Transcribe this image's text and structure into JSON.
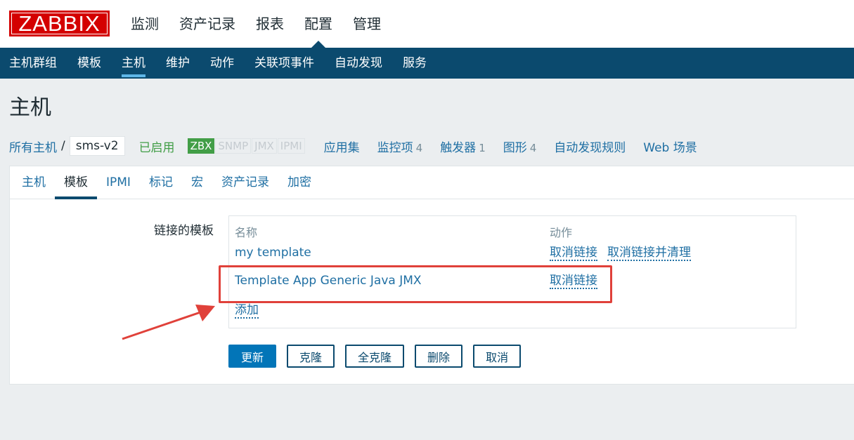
{
  "logo": {
    "text": "ZABBIX"
  },
  "main_nav": [
    {
      "label": "监测"
    },
    {
      "label": "资产记录"
    },
    {
      "label": "报表"
    },
    {
      "label": "配置",
      "active": true
    },
    {
      "label": "管理"
    }
  ],
  "sub_nav": [
    {
      "label": "主机群组"
    },
    {
      "label": "模板"
    },
    {
      "label": "主机",
      "active": true
    },
    {
      "label": "维护"
    },
    {
      "label": "动作"
    },
    {
      "label": "关联项事件"
    },
    {
      "label": "自动发现"
    },
    {
      "label": "服务"
    }
  ],
  "page_title": "主机",
  "breadcrumb": {
    "all_hosts": "所有主机",
    "separator": "/",
    "host": "sms-v2",
    "status": "已启用",
    "availability": [
      "ZBX",
      "SNMP",
      "JMX",
      "IPMI"
    ],
    "links": [
      {
        "label": "应用集",
        "count": ""
      },
      {
        "label": "监控项",
        "count": "4"
      },
      {
        "label": "触发器",
        "count": "1"
      },
      {
        "label": "图形",
        "count": "4"
      },
      {
        "label": "自动发现规则",
        "count": ""
      },
      {
        "label": "Web 场景",
        "count": ""
      }
    ]
  },
  "tabs": [
    {
      "label": "主机"
    },
    {
      "label": "模板",
      "active": true
    },
    {
      "label": "IPMI"
    },
    {
      "label": "标记"
    },
    {
      "label": "宏"
    },
    {
      "label": "资产记录"
    },
    {
      "label": "加密"
    }
  ],
  "form": {
    "linked_label": "链接的模板",
    "columns": {
      "name": "名称",
      "action": "动作"
    },
    "templates": [
      {
        "name": "my template",
        "actions": [
          "取消链接",
          "取消链接并清理"
        ]
      },
      {
        "name": "Template App Generic Java JMX",
        "actions": [
          "取消链接"
        ]
      }
    ],
    "add_label": "添加"
  },
  "buttons": {
    "update": "更新",
    "clone": "克隆",
    "full_clone": "全克隆",
    "delete": "删除",
    "cancel": "取消"
  },
  "colors": {
    "brand": "#d40000",
    "nav": "#0b4a6e",
    "link": "#1f6fa3",
    "enabled": "#429e47",
    "annotation": "#e0413a"
  }
}
